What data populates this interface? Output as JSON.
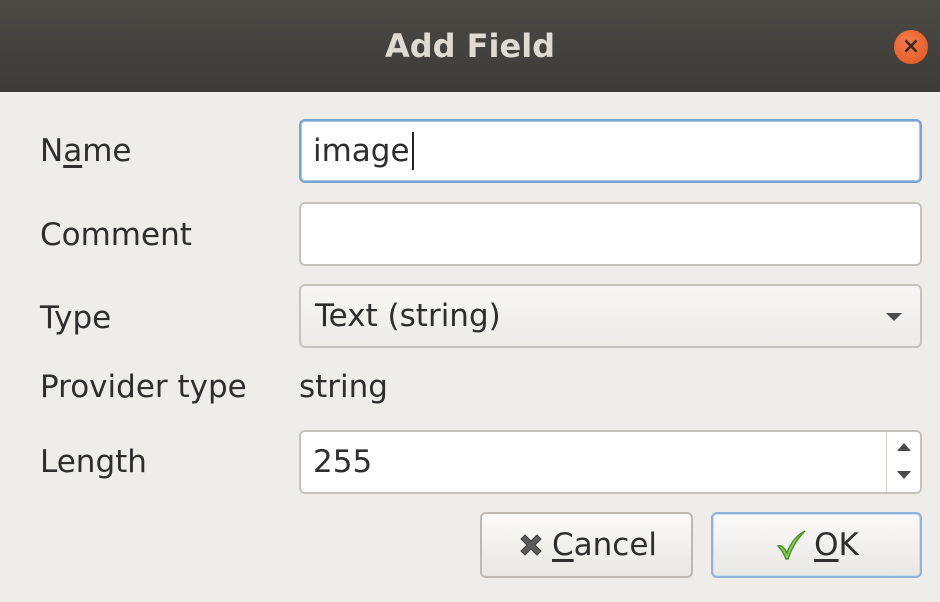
{
  "window": {
    "title": "Add Field",
    "close_symbol": "×"
  },
  "form": {
    "name": {
      "label_prefix": "N",
      "label_mnemonic": "a",
      "label_suffix": "me",
      "value": "image"
    },
    "comment": {
      "label": "Comment",
      "value": ""
    },
    "type": {
      "label": "Type",
      "selected": "Text (string)"
    },
    "provider_type": {
      "label": "Provider type",
      "value": "string"
    },
    "length": {
      "label": "Length",
      "value": "255"
    }
  },
  "buttons": {
    "cancel": {
      "mnemonic": "C",
      "rest": "ancel",
      "icon": "cancel-x-icon"
    },
    "ok": {
      "mnemonic": "O",
      "rest": "K",
      "icon": "checkmark-icon"
    }
  },
  "colors": {
    "titlebar": "#3c3b37",
    "close_button": "#e0561c",
    "focus_border": "#7aa3cf",
    "ok_check": "#6ab04c"
  }
}
